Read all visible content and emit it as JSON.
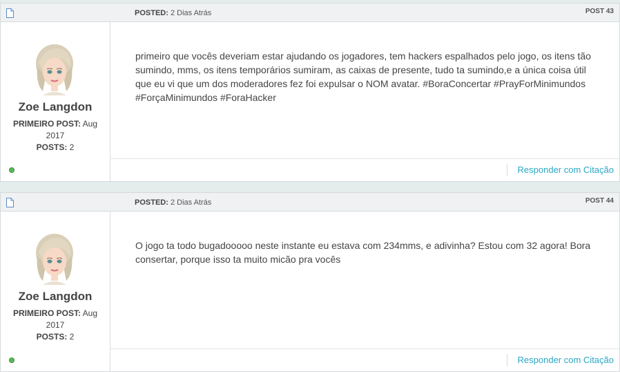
{
  "posts": [
    {
      "posted_label": "POSTED:",
      "posted_time": "2 Dias Atrás",
      "post_number": "POST 43",
      "user": {
        "name": "Zoe Langdon",
        "first_post_label": "PRIMEIRO POST:",
        "first_post_value": "Aug 2017",
        "posts_label": "POSTS:",
        "posts_value": "2",
        "status": "online"
      },
      "content": "primeiro que vocês deveriam estar ajudando os jogadores, tem hackers espalhados pelo jogo, os itens tão sumindo, mms, os itens temporários sumiram, as caixas de presente, tudo ta sumindo,e a única coisa útil que eu vi que um dos moderadores fez foi expulsar o NOM avatar. #BoraConcertar #PrayForMinimundos #ForçaMinimundos #ForaHacker",
      "reply_label": "Responder com Citação"
    },
    {
      "posted_label": "POSTED:",
      "posted_time": "2 Dias Atrás",
      "post_number": "POST 44",
      "user": {
        "name": "Zoe Langdon",
        "first_post_label": "PRIMEIRO POST:",
        "first_post_value": "Aug 2017",
        "posts_label": "POSTS:",
        "posts_value": "2",
        "status": "online"
      },
      "content": "O jogo ta todo bugadooooo neste instante eu estava com 234mms, e adivinha? Estou com 32 agora! Bora consertar, porque isso ta muito micão pra vocês",
      "reply_label": "Responder com Citação"
    }
  ],
  "colors": {
    "accent_link": "#2aa6c4",
    "online": "#5cb85c",
    "header_bg": "#eff1f2"
  },
  "icons": {
    "post_icon": "document-icon",
    "status_icon": "online-status-icon"
  }
}
